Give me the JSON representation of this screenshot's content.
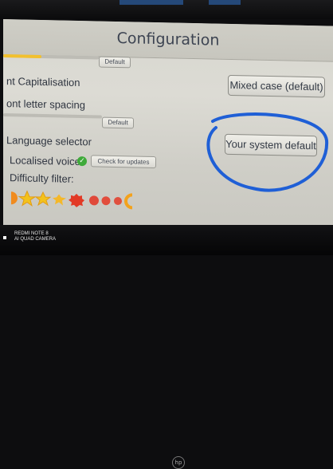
{
  "config": {
    "title": "Configuration",
    "default_label": "Default",
    "font_capitalisation": {
      "label": "nt Capitalisation",
      "value": "Mixed case (default)"
    },
    "font_spacing": {
      "label": "ont letter spacing",
      "default_label": "Default"
    },
    "language_selector": {
      "label": "Language selector",
      "value": "Your system default"
    },
    "localised_voices": {
      "label": "Localised voices",
      "button": "Check for updates"
    },
    "difficulty": {
      "label": "Difficulty filter:"
    }
  },
  "watermark": {
    "line1": "REDMI NOTE 8",
    "line2": "AI QUAD CAMERA"
  },
  "colors": {
    "annotation": "#1f5fd6",
    "slider_fill": "#f2c02e",
    "check": "#3faa3a"
  },
  "difficulty_icons": [
    "half-circle",
    "star",
    "star",
    "star-burst",
    "burst",
    "splat",
    "splat",
    "splat-half",
    "half-ring"
  ]
}
